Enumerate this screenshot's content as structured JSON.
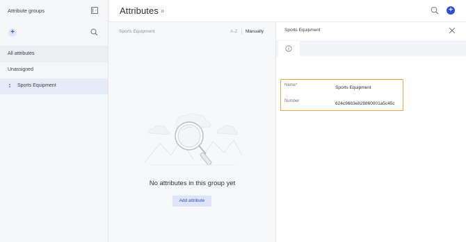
{
  "sidebar": {
    "title": "Attribute groups",
    "groups": [
      {
        "label": "All attributes"
      },
      {
        "label": "Unassigned"
      },
      {
        "label": "Sports Equipment"
      }
    ]
  },
  "header": {
    "title": "Attributes",
    "count": "0"
  },
  "middle": {
    "group_name": "Sports Equipment",
    "sort_az": "A-Z",
    "sort_manual": "Manually",
    "empty_title": "No attributes in this group yet",
    "add_button": "Add attribute"
  },
  "detail": {
    "title": "Sports Equipment",
    "fields": {
      "name_label": "Name",
      "name_required": "*",
      "name_value": "Sports Equipment",
      "number_label": "Number",
      "number_value": "624c9683e828860001a5c45c"
    }
  },
  "colors": {
    "accent": "#2f4fd4",
    "highlight_border": "#f1a33d",
    "selected_row": "#e5eaf7"
  },
  "icons": [
    "collapse-sidebar-icon",
    "plus-icon",
    "search-icon",
    "drag-handle-icon",
    "close-icon",
    "info-icon"
  ]
}
